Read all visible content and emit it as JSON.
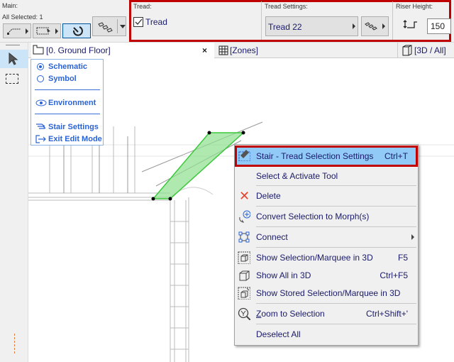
{
  "infobox": {
    "main_label": "Main:",
    "selection_count": "All Selected: 1",
    "tread_label": "Tread:",
    "tread_checkbox_label": "Tread",
    "tread_checked": true,
    "tread_settings_label": "Tread Settings:",
    "tread_settings_value": "Tread 22",
    "riser_height_label": "Riser Height:",
    "riser_height_value": "150"
  },
  "tabs": [
    {
      "label": "[0. Ground Floor]",
      "icon": "floor-plan-icon"
    },
    {
      "label": "[Zones]",
      "icon": "grid-icon"
    },
    {
      "label": "[3D / All]",
      "icon": "cube-icon"
    }
  ],
  "quick_options": {
    "items": [
      {
        "label": "Schematic",
        "icon": "radio-checked-icon"
      },
      {
        "label": "Symbol",
        "icon": "radio-icon"
      },
      {
        "label": "Environment",
        "icon": "eye-icon"
      },
      {
        "label": "Stair Settings",
        "icon": "stair-settings-icon"
      },
      {
        "label": "Exit Edit Mode",
        "icon": "exit-icon"
      }
    ]
  },
  "context_menu": {
    "items": [
      {
        "label": "Stair - Tread Selection Settings",
        "shortcut": "Ctrl+T",
        "icon": "tread-settings-icon",
        "highlighted": true
      },
      {
        "label": "Select & Activate Tool",
        "shortcut": ""
      },
      {
        "label": "Delete",
        "shortcut": "",
        "icon": "delete-x-icon"
      },
      {
        "label": "Convert Selection to Morph(s)",
        "shortcut": "",
        "icon": "morph-icon"
      },
      {
        "label": "Connect",
        "shortcut": "",
        "icon": "connect-icon",
        "submenu": true
      },
      {
        "label": "Show Selection/Marquee in 3D",
        "shortcut": "F5",
        "icon": "marquee-3d-icon"
      },
      {
        "label": "Show All in 3D",
        "shortcut": "Ctrl+F5",
        "icon": "cube-icon"
      },
      {
        "label": "Show Stored Selection/Marquee in 3D",
        "shortcut": "",
        "icon": "stored-marquee-3d-icon"
      },
      {
        "label": "Zoom to Selection",
        "shortcut": "Ctrl+Shift+'",
        "icon": "zoom-selection-icon"
      },
      {
        "label": "Deselect All",
        "shortcut": ""
      }
    ]
  },
  "colors": {
    "highlight": "#91c9f7",
    "callout": "#c00000",
    "selection": "#3cc83c",
    "quick_text": "#2a63d6"
  }
}
